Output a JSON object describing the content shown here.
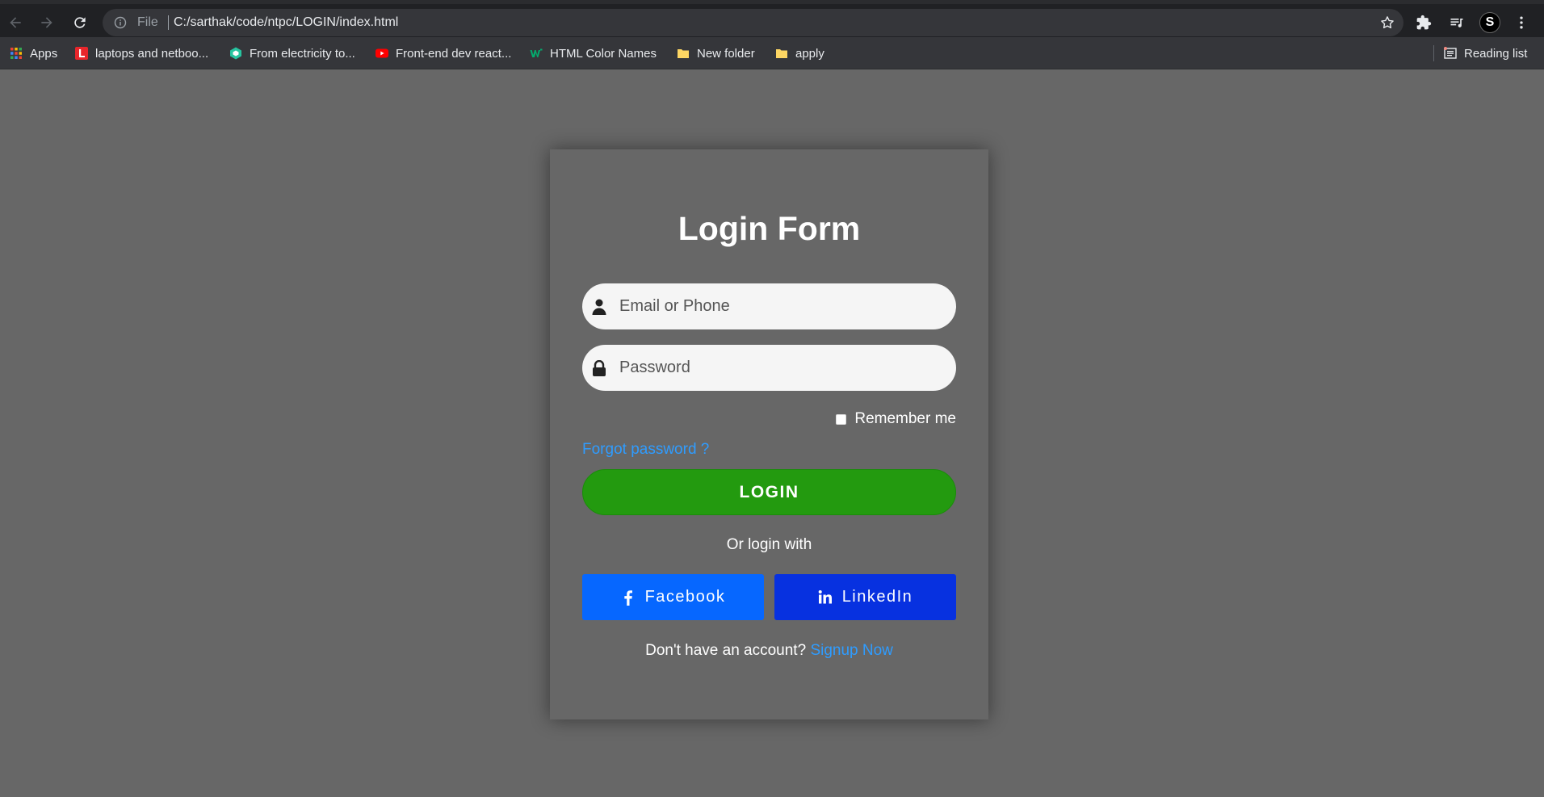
{
  "browser": {
    "omnibox": {
      "scheme_label": "File",
      "url": "C:/sarthak/code/ntpc/LOGIN/index.html"
    },
    "nav_icons": [
      "back-icon",
      "forward-icon",
      "reload-icon"
    ],
    "toolbar_icons": [
      "bookmark-star-icon",
      "extensions-icon",
      "media-icon",
      "profile-avatar",
      "menu-icon"
    ],
    "profile_letter": "S",
    "bookmarks": [
      {
        "label": "Apps",
        "icon": "apps-grid-icon"
      },
      {
        "label": "laptops and netboo...",
        "icon": "l-logo-icon",
        "color": "#e8262b"
      },
      {
        "label": "From electricity to...",
        "icon": "brainly-icon",
        "color": "#27c4a0"
      },
      {
        "label": "Front-end dev react...",
        "icon": "youtube-icon",
        "color": "#ff0000"
      },
      {
        "label": "HTML Color Names",
        "icon": "w3-icon",
        "color": "#04aa6d"
      },
      {
        "label": "New folder",
        "icon": "folder-icon",
        "color": "#fdd663"
      },
      {
        "label": "apply",
        "icon": "folder-icon",
        "color": "#fdd663"
      }
    ],
    "reading_list": "Reading list"
  },
  "login": {
    "title": "Login Form",
    "email_placeholder": "Email or Phone",
    "password_placeholder": "Password",
    "remember_label": "Remember me",
    "forgot_label": "Forgot password ?",
    "login_button": "LOGIN",
    "or_login_with": "Or login with",
    "facebook_label": "Facebook",
    "linkedin_label": "LinkedIn",
    "signup_prompt": "Don't have an account?",
    "signup_link": "Signup Now"
  },
  "colors": {
    "page_bg": "#676767",
    "login_button": "#239a0f",
    "facebook": "#0667ff",
    "linkedin": "#0731e0",
    "link": "#2f9cff"
  }
}
